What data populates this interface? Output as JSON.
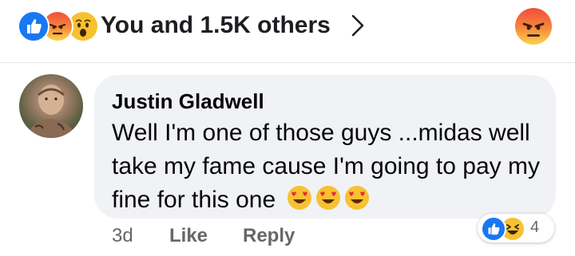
{
  "reactions_summary": {
    "text": "You and 1.5K others",
    "icons": [
      "like-icon",
      "angry-icon",
      "wow-icon"
    ]
  },
  "current_reaction": {
    "icon": "angry-icon"
  },
  "comment": {
    "author": "Justin Gladwell",
    "text": "Well I'm one of those guys ...midas well take my fame cause I'm going to pay my fine for this one",
    "emojis": [
      "heart-eyes-emoji",
      "heart-eyes-emoji",
      "heart-eyes-emoji"
    ],
    "reactions": {
      "icons": [
        "like-icon",
        "haha-icon"
      ],
      "count": "4"
    },
    "actions": {
      "time": "3d",
      "like": "Like",
      "reply": "Reply"
    }
  },
  "colors": {
    "like_blue": "#1877f2",
    "bubble_bg": "#f0f2f5",
    "muted_text": "#65676b",
    "wow_yellow": "#f7c132"
  }
}
